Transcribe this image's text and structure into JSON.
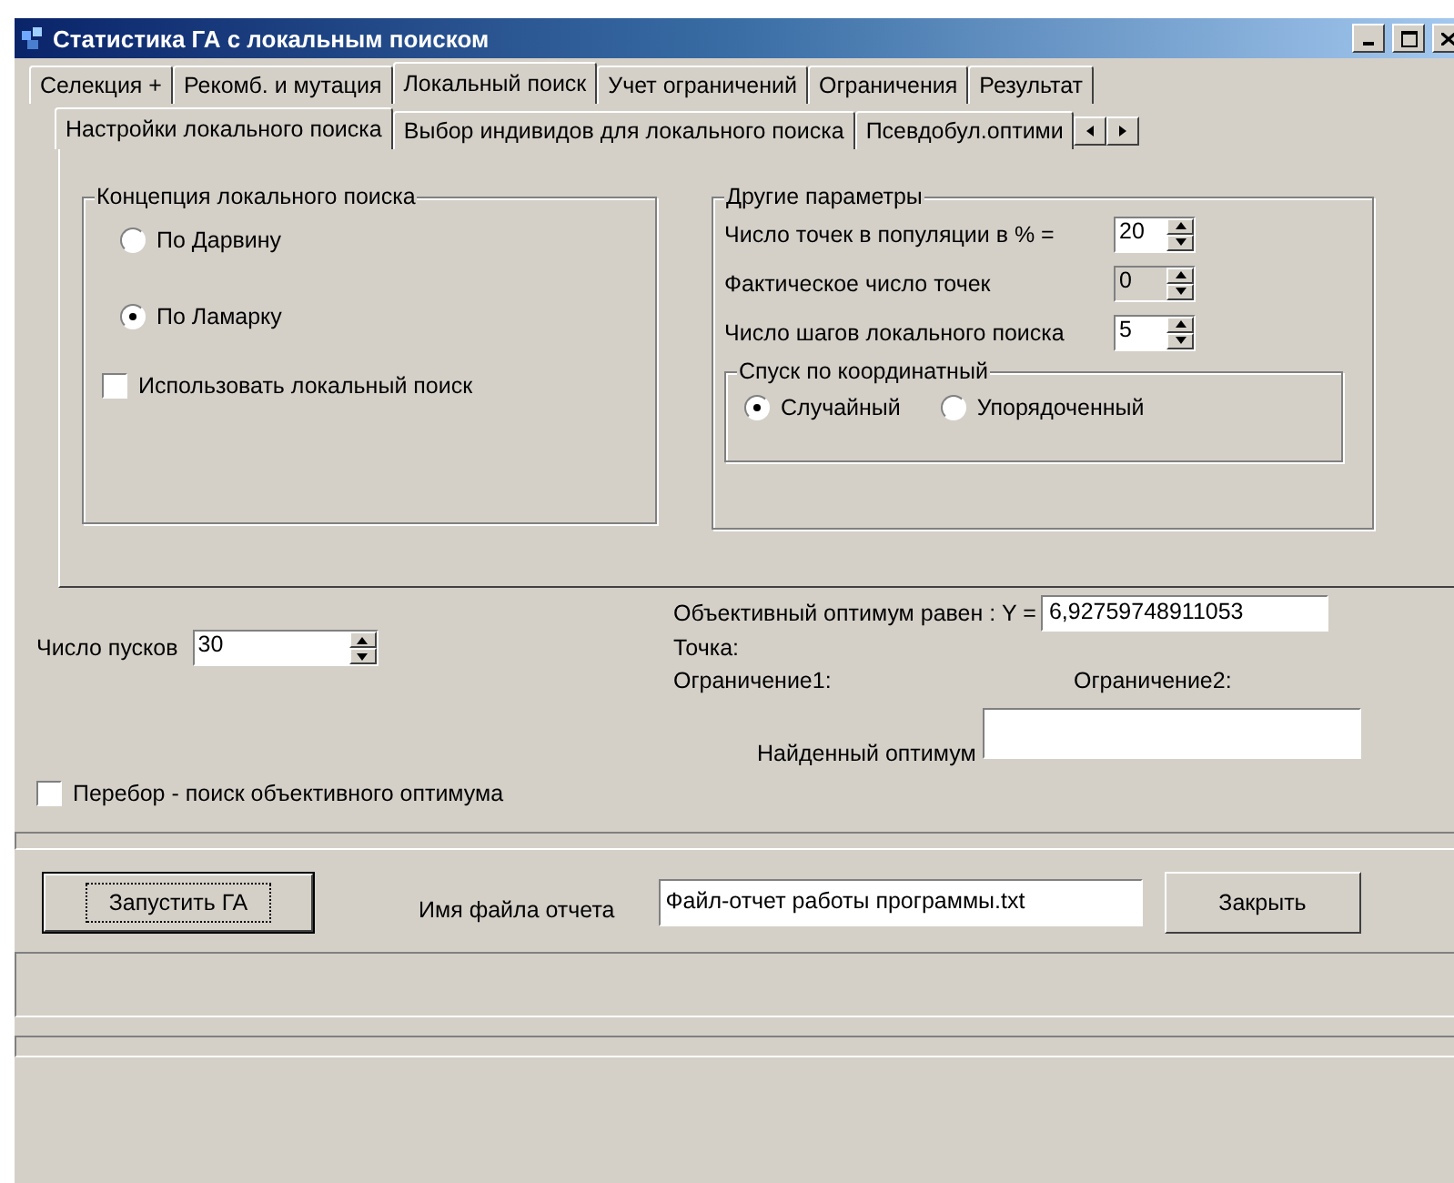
{
  "window": {
    "title": "Статистика ГА с локальным поиском"
  },
  "tabs": [
    {
      "label": "Селекция +",
      "selected": false
    },
    {
      "label": "Рекомб. и мутация",
      "selected": false
    },
    {
      "label": "Локальный поиск",
      "selected": true
    },
    {
      "label": "Учет ограничений",
      "selected": false
    },
    {
      "label": "Ограничения",
      "selected": false
    },
    {
      "label": "Результат",
      "selected": false
    }
  ],
  "subtabs": [
    {
      "label": "Настройки локального поиска",
      "selected": true
    },
    {
      "label": "Выбор индивидов для локального поиска",
      "selected": false
    },
    {
      "label": "Псевдобул.оптими",
      "selected": false
    }
  ],
  "concept": {
    "title": "Концепция локального поиска",
    "options": [
      {
        "label": "По Дарвину",
        "selected": false
      },
      {
        "label": "По Ламарку",
        "selected": true
      }
    ],
    "use_local": {
      "label": "Использовать локальный поиск",
      "checked": false
    }
  },
  "other": {
    "title": "Другие параметры",
    "fields": [
      {
        "label": "Число точек в популяции в % =",
        "value": "20",
        "disabled": false
      },
      {
        "label": "Фактическое число точек",
        "value": "0",
        "disabled": true
      },
      {
        "label": "Число шагов локального поиска",
        "value": "5",
        "disabled": false
      }
    ],
    "descent": {
      "title": "Спуск по координатный",
      "options": [
        {
          "label": "Случайный",
          "selected": true
        },
        {
          "label": "Упорядоченный",
          "selected": false
        }
      ]
    }
  },
  "runs": {
    "label": "Число пусков",
    "value": "30"
  },
  "optimum": {
    "label": "Объективный оптимум равен : Y =",
    "value": "6,92759748911053"
  },
  "point_label": "Точка:",
  "constraint1": "Ограничение1:",
  "constraint2": "Ограничение2:",
  "brute": {
    "label": "Перебор - поиск объективного оптимума",
    "checked": false
  },
  "found": {
    "label": "Найденный оптимум"
  },
  "run_button": "Запустить ГА",
  "report": {
    "label": "Имя файла отчета",
    "value": "Файл-отчет работы программы.txt"
  },
  "close_button": "Закрыть"
}
